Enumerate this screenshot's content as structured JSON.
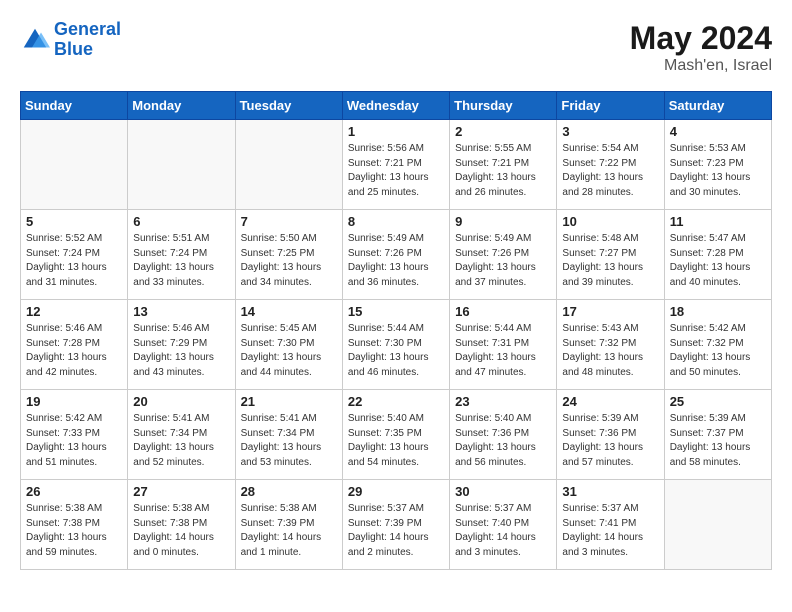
{
  "header": {
    "logo_line1": "General",
    "logo_line2": "Blue",
    "month_year": "May 2024",
    "location": "Mash'en, Israel"
  },
  "days_of_week": [
    "Sunday",
    "Monday",
    "Tuesday",
    "Wednesday",
    "Thursday",
    "Friday",
    "Saturday"
  ],
  "weeks": [
    [
      {
        "day": "",
        "sunrise": "",
        "sunset": "",
        "daylight": ""
      },
      {
        "day": "",
        "sunrise": "",
        "sunset": "",
        "daylight": ""
      },
      {
        "day": "",
        "sunrise": "",
        "sunset": "",
        "daylight": ""
      },
      {
        "day": "1",
        "sunrise": "Sunrise: 5:56 AM",
        "sunset": "Sunset: 7:21 PM",
        "daylight": "Daylight: 13 hours and 25 minutes."
      },
      {
        "day": "2",
        "sunrise": "Sunrise: 5:55 AM",
        "sunset": "Sunset: 7:21 PM",
        "daylight": "Daylight: 13 hours and 26 minutes."
      },
      {
        "day": "3",
        "sunrise": "Sunrise: 5:54 AM",
        "sunset": "Sunset: 7:22 PM",
        "daylight": "Daylight: 13 hours and 28 minutes."
      },
      {
        "day": "4",
        "sunrise": "Sunrise: 5:53 AM",
        "sunset": "Sunset: 7:23 PM",
        "daylight": "Daylight: 13 hours and 30 minutes."
      }
    ],
    [
      {
        "day": "5",
        "sunrise": "Sunrise: 5:52 AM",
        "sunset": "Sunset: 7:24 PM",
        "daylight": "Daylight: 13 hours and 31 minutes."
      },
      {
        "day": "6",
        "sunrise": "Sunrise: 5:51 AM",
        "sunset": "Sunset: 7:24 PM",
        "daylight": "Daylight: 13 hours and 33 minutes."
      },
      {
        "day": "7",
        "sunrise": "Sunrise: 5:50 AM",
        "sunset": "Sunset: 7:25 PM",
        "daylight": "Daylight: 13 hours and 34 minutes."
      },
      {
        "day": "8",
        "sunrise": "Sunrise: 5:49 AM",
        "sunset": "Sunset: 7:26 PM",
        "daylight": "Daylight: 13 hours and 36 minutes."
      },
      {
        "day": "9",
        "sunrise": "Sunrise: 5:49 AM",
        "sunset": "Sunset: 7:26 PM",
        "daylight": "Daylight: 13 hours and 37 minutes."
      },
      {
        "day": "10",
        "sunrise": "Sunrise: 5:48 AM",
        "sunset": "Sunset: 7:27 PM",
        "daylight": "Daylight: 13 hours and 39 minutes."
      },
      {
        "day": "11",
        "sunrise": "Sunrise: 5:47 AM",
        "sunset": "Sunset: 7:28 PM",
        "daylight": "Daylight: 13 hours and 40 minutes."
      }
    ],
    [
      {
        "day": "12",
        "sunrise": "Sunrise: 5:46 AM",
        "sunset": "Sunset: 7:28 PM",
        "daylight": "Daylight: 13 hours and 42 minutes."
      },
      {
        "day": "13",
        "sunrise": "Sunrise: 5:46 AM",
        "sunset": "Sunset: 7:29 PM",
        "daylight": "Daylight: 13 hours and 43 minutes."
      },
      {
        "day": "14",
        "sunrise": "Sunrise: 5:45 AM",
        "sunset": "Sunset: 7:30 PM",
        "daylight": "Daylight: 13 hours and 44 minutes."
      },
      {
        "day": "15",
        "sunrise": "Sunrise: 5:44 AM",
        "sunset": "Sunset: 7:30 PM",
        "daylight": "Daylight: 13 hours and 46 minutes."
      },
      {
        "day": "16",
        "sunrise": "Sunrise: 5:44 AM",
        "sunset": "Sunset: 7:31 PM",
        "daylight": "Daylight: 13 hours and 47 minutes."
      },
      {
        "day": "17",
        "sunrise": "Sunrise: 5:43 AM",
        "sunset": "Sunset: 7:32 PM",
        "daylight": "Daylight: 13 hours and 48 minutes."
      },
      {
        "day": "18",
        "sunrise": "Sunrise: 5:42 AM",
        "sunset": "Sunset: 7:32 PM",
        "daylight": "Daylight: 13 hours and 50 minutes."
      }
    ],
    [
      {
        "day": "19",
        "sunrise": "Sunrise: 5:42 AM",
        "sunset": "Sunset: 7:33 PM",
        "daylight": "Daylight: 13 hours and 51 minutes."
      },
      {
        "day": "20",
        "sunrise": "Sunrise: 5:41 AM",
        "sunset": "Sunset: 7:34 PM",
        "daylight": "Daylight: 13 hours and 52 minutes."
      },
      {
        "day": "21",
        "sunrise": "Sunrise: 5:41 AM",
        "sunset": "Sunset: 7:34 PM",
        "daylight": "Daylight: 13 hours and 53 minutes."
      },
      {
        "day": "22",
        "sunrise": "Sunrise: 5:40 AM",
        "sunset": "Sunset: 7:35 PM",
        "daylight": "Daylight: 13 hours and 54 minutes."
      },
      {
        "day": "23",
        "sunrise": "Sunrise: 5:40 AM",
        "sunset": "Sunset: 7:36 PM",
        "daylight": "Daylight: 13 hours and 56 minutes."
      },
      {
        "day": "24",
        "sunrise": "Sunrise: 5:39 AM",
        "sunset": "Sunset: 7:36 PM",
        "daylight": "Daylight: 13 hours and 57 minutes."
      },
      {
        "day": "25",
        "sunrise": "Sunrise: 5:39 AM",
        "sunset": "Sunset: 7:37 PM",
        "daylight": "Daylight: 13 hours and 58 minutes."
      }
    ],
    [
      {
        "day": "26",
        "sunrise": "Sunrise: 5:38 AM",
        "sunset": "Sunset: 7:38 PM",
        "daylight": "Daylight: 13 hours and 59 minutes."
      },
      {
        "day": "27",
        "sunrise": "Sunrise: 5:38 AM",
        "sunset": "Sunset: 7:38 PM",
        "daylight": "Daylight: 14 hours and 0 minutes."
      },
      {
        "day": "28",
        "sunrise": "Sunrise: 5:38 AM",
        "sunset": "Sunset: 7:39 PM",
        "daylight": "Daylight: 14 hours and 1 minute."
      },
      {
        "day": "29",
        "sunrise": "Sunrise: 5:37 AM",
        "sunset": "Sunset: 7:39 PM",
        "daylight": "Daylight: 14 hours and 2 minutes."
      },
      {
        "day": "30",
        "sunrise": "Sunrise: 5:37 AM",
        "sunset": "Sunset: 7:40 PM",
        "daylight": "Daylight: 14 hours and 3 minutes."
      },
      {
        "day": "31",
        "sunrise": "Sunrise: 5:37 AM",
        "sunset": "Sunset: 7:41 PM",
        "daylight": "Daylight: 14 hours and 3 minutes."
      },
      {
        "day": "",
        "sunrise": "",
        "sunset": "",
        "daylight": ""
      }
    ]
  ]
}
